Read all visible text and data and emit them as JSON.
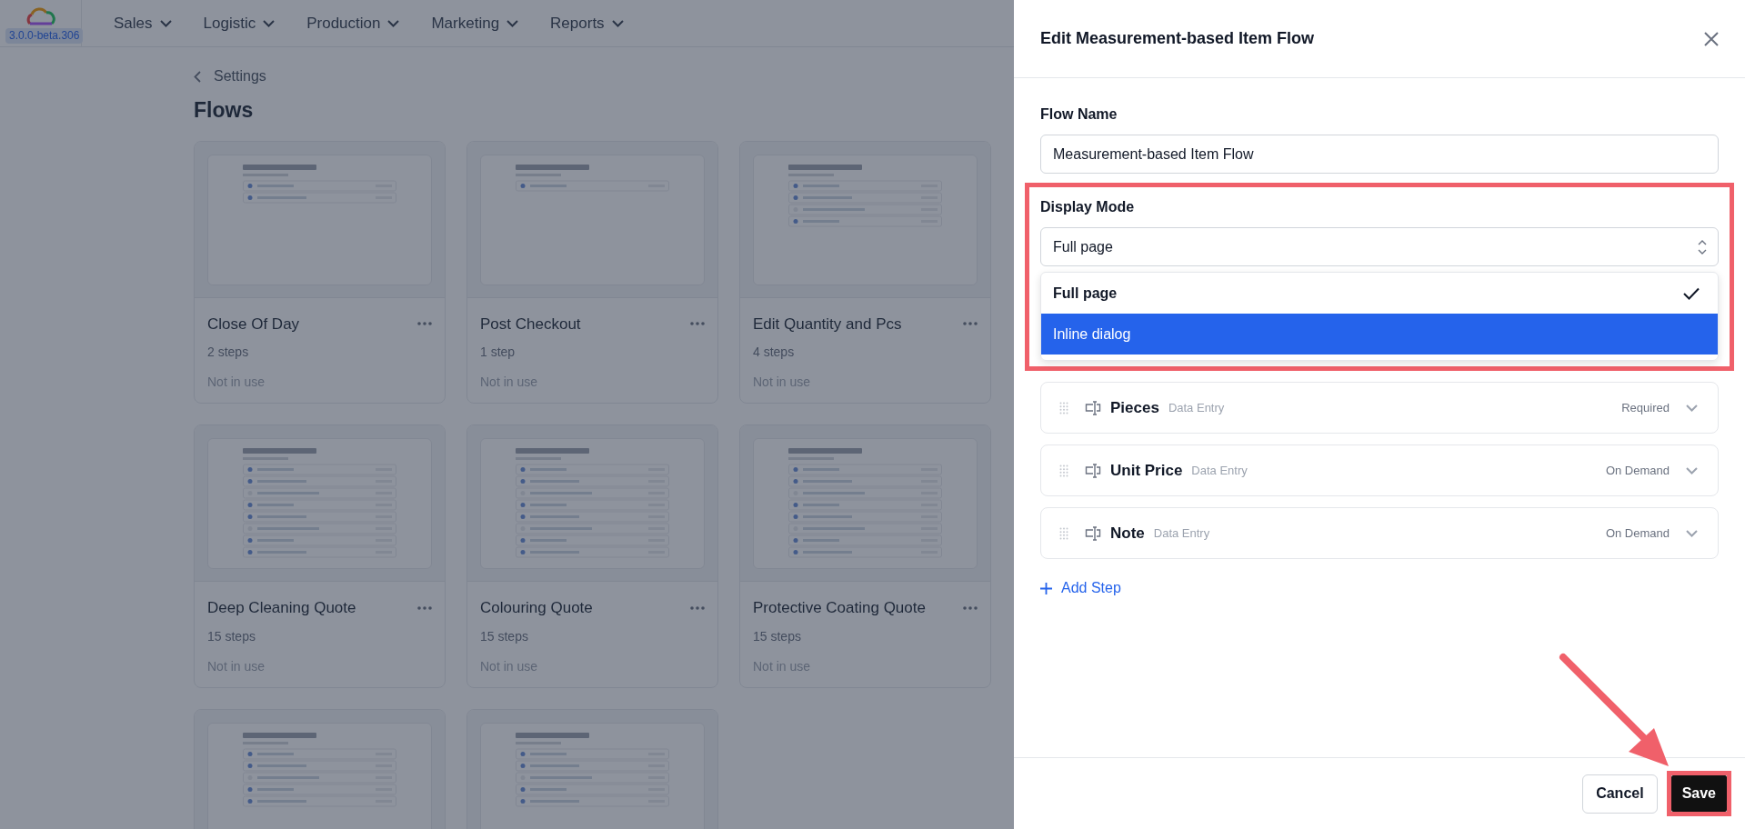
{
  "app": {
    "version": "3.0.0-beta.306",
    "menu": [
      {
        "label": "Sales"
      },
      {
        "label": "Logistic"
      },
      {
        "label": "Production"
      },
      {
        "label": "Marketing"
      },
      {
        "label": "Reports"
      }
    ]
  },
  "page": {
    "breadcrumb": "Settings",
    "title": "Flows"
  },
  "flows": [
    {
      "title": "Close Of Day",
      "steps": "2 steps",
      "usage": "Not in use",
      "preview": [
        true,
        true
      ]
    },
    {
      "title": "Post Checkout",
      "steps": "1 step",
      "usage": "Not in use",
      "preview": [
        true
      ]
    },
    {
      "title": "Edit Quantity and Pcs",
      "steps": "4 steps",
      "usage": "Not in use",
      "preview": [
        true,
        true,
        false,
        true
      ]
    },
    {
      "title": "Deep Cleaning Quote",
      "steps": "15 steps",
      "usage": "Not in use",
      "preview": [
        true,
        true,
        false,
        true,
        true,
        false,
        true,
        true
      ]
    },
    {
      "title": "Colouring Quote",
      "steps": "15 steps",
      "usage": "Not in use",
      "preview": [
        true,
        true,
        false,
        true,
        true,
        false,
        true,
        true
      ]
    },
    {
      "title": "Protective Coating Quote",
      "steps": "15 steps",
      "usage": "Not in use",
      "preview": [
        true,
        true,
        false,
        true,
        true,
        false,
        true,
        true
      ]
    },
    {
      "preview": [
        true,
        true,
        false,
        true,
        true
      ]
    },
    {
      "preview": [
        true,
        true,
        false,
        true,
        true
      ]
    }
  ],
  "panel": {
    "title": "Edit Measurement-based Item Flow",
    "flow_name": {
      "label": "Flow Name",
      "value": "Measurement-based Item Flow"
    },
    "display_mode": {
      "label": "Display Mode",
      "value": "Full page",
      "expanded": true,
      "annotated": true,
      "options": [
        {
          "label": "Full page",
          "checked": true,
          "highlighted": false
        },
        {
          "label": "Inline dialog",
          "checked": false,
          "highlighted": true
        }
      ]
    },
    "steps": [
      {
        "name": "Pieces",
        "type": "Data Entry",
        "requirement": "Required"
      },
      {
        "name": "Unit Price",
        "type": "Data Entry",
        "requirement": "On Demand"
      },
      {
        "name": "Note",
        "type": "Data Entry",
        "requirement": "On Demand"
      }
    ],
    "add_step": "Add Step",
    "buttons": [
      {
        "label": "Cancel",
        "kind": "secondary",
        "annotated": false
      },
      {
        "label": "Save",
        "kind": "primary",
        "annotated": true
      }
    ]
  }
}
